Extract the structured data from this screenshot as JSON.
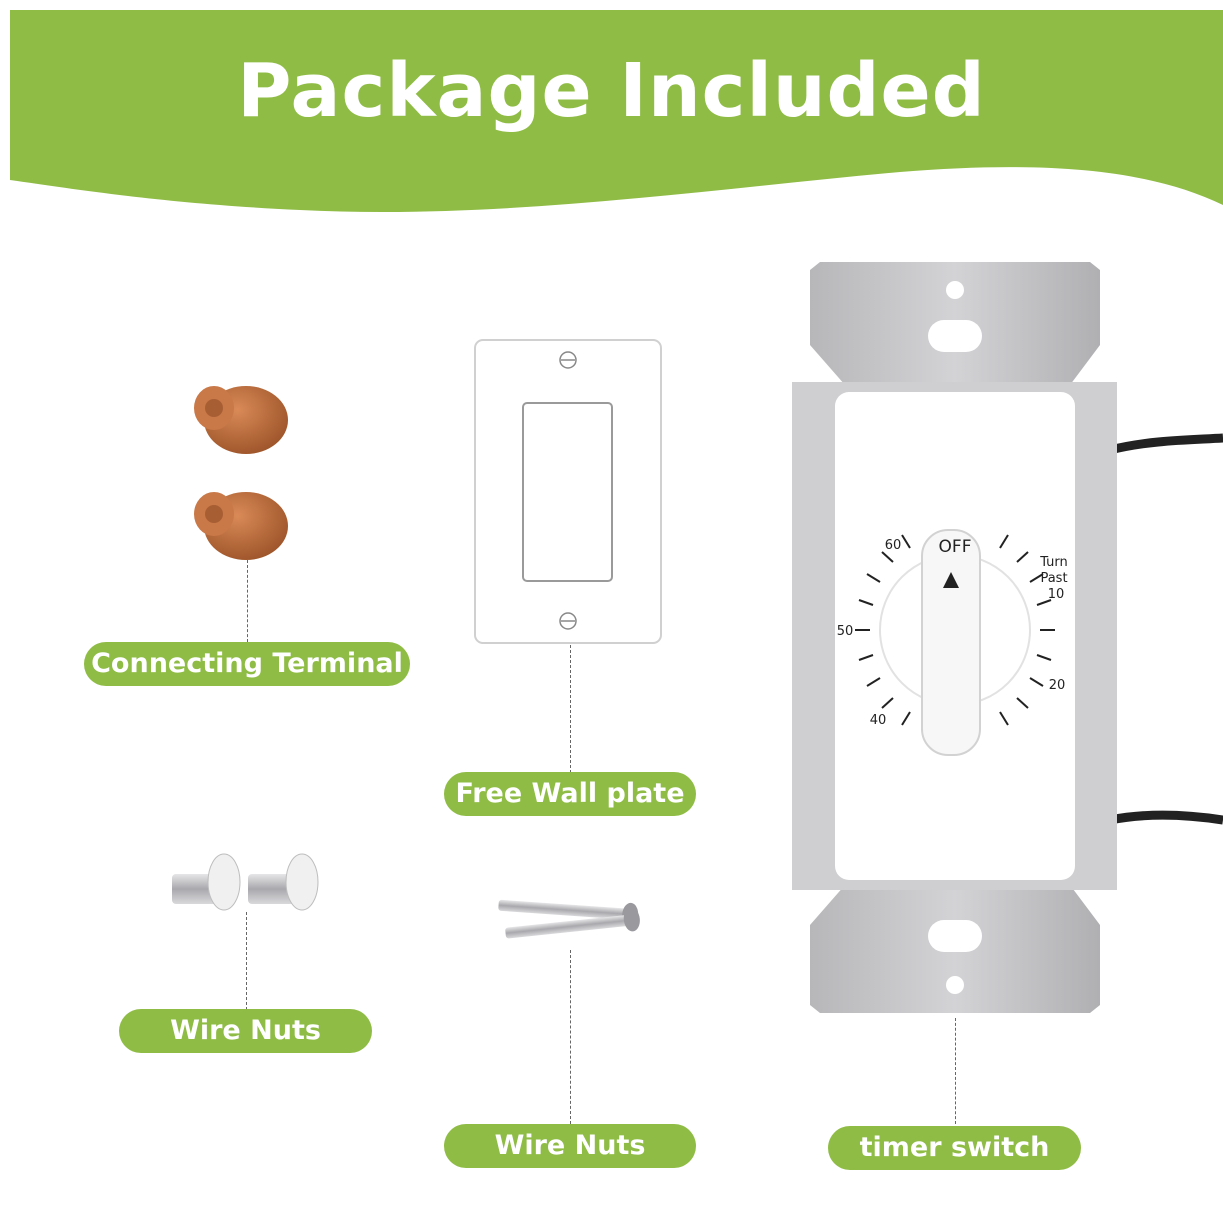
{
  "title": "Package Included",
  "colors": {
    "accent_green": "#8fbc45",
    "wire_nut_orange": "#b86a3c",
    "metal_gray": "#c9c9cb"
  },
  "items": {
    "connecting_terminal": {
      "label": "Connecting Terminal"
    },
    "wall_plate": {
      "label": "Free Wall plate"
    },
    "screws_small": {
      "label": "Wire Nuts"
    },
    "screws_long": {
      "label": "Wire Nuts"
    },
    "timer_switch": {
      "label": "timer switch"
    }
  },
  "dial": {
    "off_label": "OFF",
    "turn_past": "Turn",
    "turn_past_2": "Past",
    "marks": [
      "60",
      "10",
      "50",
      "20",
      "40"
    ]
  }
}
